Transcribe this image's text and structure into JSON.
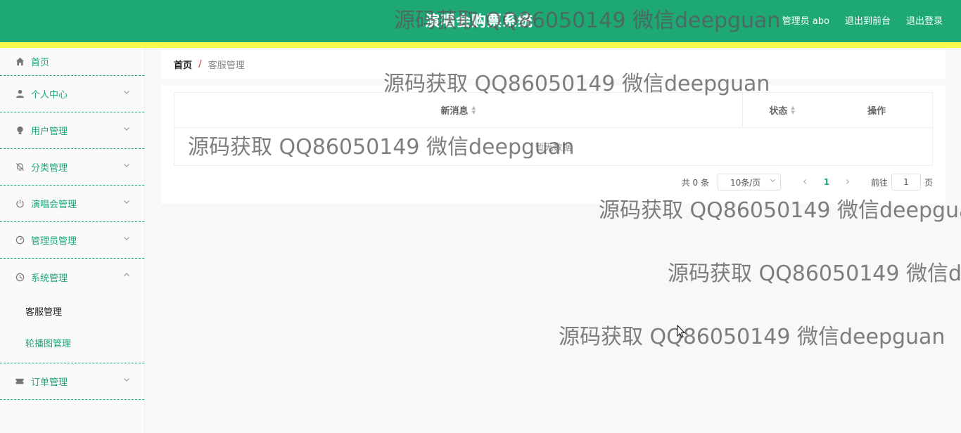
{
  "header": {
    "title": "演唱会购票系统",
    "links": [
      "管理员 abo",
      "退出到前台",
      "退出登录"
    ],
    "bg_color": "#1da875",
    "strip_color": "#f6fb4f"
  },
  "sidebar": {
    "items": [
      {
        "label": "首页",
        "icon": "home-icon"
      },
      {
        "label": "个人中心",
        "icon": "user-icon"
      },
      {
        "label": "用户管理",
        "icon": "bulb-icon"
      },
      {
        "label": "分类管理",
        "icon": "bell-off-icon"
      },
      {
        "label": "演唱会管理",
        "icon": "power-icon"
      },
      {
        "label": "管理员管理",
        "icon": "gauge-icon"
      },
      {
        "label": "系统管理",
        "icon": "clock-icon"
      },
      {
        "label": "订单管理",
        "icon": "ticket-icon"
      }
    ],
    "submenu": [
      "客服管理",
      "轮播图管理"
    ]
  },
  "breadcrumb": {
    "home": "首页",
    "separator": "/",
    "current": "客服管理"
  },
  "table": {
    "columns": [
      "新消息",
      "状态",
      "操作"
    ],
    "empty_text": "暂无数据"
  },
  "pagination": {
    "total": "共 0 条",
    "page_size": "10条/页",
    "current_page": "1",
    "goto_label": "前往",
    "goto_value": "1",
    "page_unit": "页"
  },
  "watermark": "源码获取 QQ86050149 微信deepguan"
}
